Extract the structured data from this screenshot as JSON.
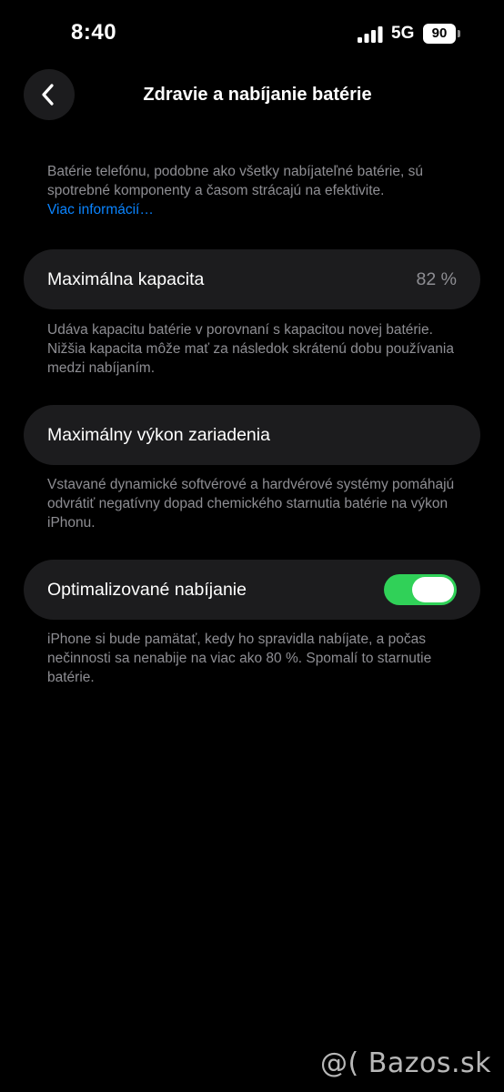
{
  "status_bar": {
    "time": "8:40",
    "network": "5G",
    "battery_level": "90",
    "signal_icon": "cellular-signal-icon",
    "battery_icon": "battery-icon"
  },
  "nav": {
    "back_icon": "chevron-left-icon",
    "title": "Zdravie a nabíjanie batérie"
  },
  "intro": {
    "text": "Batérie telefónu, podobne ako všetky nabíjateľné batérie, sú spotrebné komponenty a časom strácajú na efektivite.",
    "link": "Viac informácií…"
  },
  "max_capacity": {
    "label": "Maximálna kapacita",
    "value": "82 %",
    "footer": "Udáva kapacitu batérie v porovnaní s kapacitou novej batérie. Nižšia kapacita môže mať za následok skrátenú dobu používania medzi nabíjaním."
  },
  "peak_performance": {
    "label": "Maximálny výkon zariadenia",
    "footer": "Vstavané dynamické softvérové a hardvérové systémy pomáhajú odvrátiť negatívny dopad chemického starnutia batérie na výkon iPhonu."
  },
  "optimized_charging": {
    "label": "Optimalizované nabíjanie",
    "enabled": true,
    "footer": "iPhone si bude pamätať, kedy ho spravidla nabíjate, a počas nečinnosti sa nenabije na viac ako 80 %. Spomalí to starnutie batérie."
  },
  "watermark": "@( Bazos.sk",
  "colors": {
    "background": "#000000",
    "cell": "#1c1c1e",
    "secondary_text": "#8e8e93",
    "link": "#0a84ff",
    "toggle_on": "#30d158"
  }
}
